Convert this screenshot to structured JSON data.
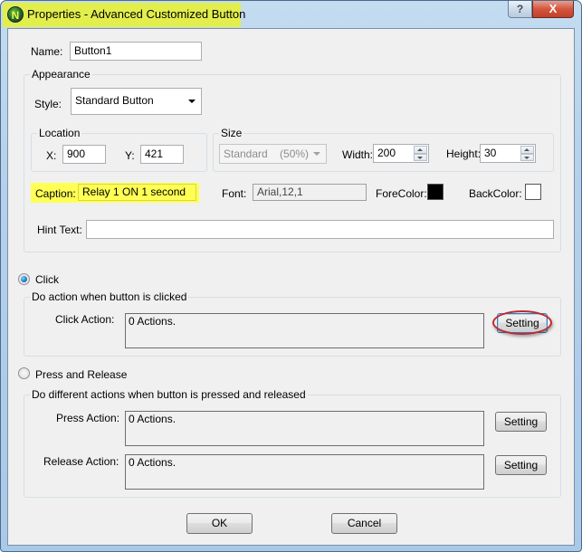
{
  "window": {
    "title": "Properties - Advanced Customized Button",
    "app_icon_letter": "N",
    "help_glyph": "?",
    "close_glyph": "X"
  },
  "name": {
    "label": "Name:",
    "value": "Button1"
  },
  "appearance": {
    "legend": "Appearance",
    "style": {
      "label": "Style:",
      "value": "Standard Button"
    },
    "location": {
      "legend": "Location",
      "x_label": "X:",
      "x_value": "900",
      "y_label": "Y:",
      "y_value": "421"
    },
    "size": {
      "legend": "Size",
      "preset_value": "Standard    (50%)",
      "width_label": "Width:",
      "width_value": "200",
      "height_label": "Height:",
      "height_value": "30"
    },
    "caption": {
      "label": "Caption:",
      "value": "Relay 1 ON 1 second",
      "highlight_color": "#ffff55"
    },
    "font": {
      "label": "Font:",
      "value": "Arial,12,1"
    },
    "forecolor": {
      "label": "ForeColor:",
      "color": "#000000"
    },
    "backcolor": {
      "label": "BackColor:",
      "color": "#ffffff"
    },
    "hint": {
      "label": "Hint Text:",
      "value": ""
    }
  },
  "click_mode": {
    "label": "Click",
    "selected": true,
    "group_legend": "Do action when button is clicked",
    "action_label": "Click Action:",
    "action_value": "0 Actions.",
    "setting_label": "Setting"
  },
  "press_release_mode": {
    "label": "Press and Release",
    "selected": false,
    "group_legend": "Do different actions when button is pressed and released",
    "press_label": "Press Action:",
    "press_value": "0 Actions.",
    "press_setting_label": "Setting",
    "release_label": "Release Action:",
    "release_value": "0 Actions.",
    "release_setting_label": "Setting"
  },
  "footer": {
    "ok_label": "OK",
    "cancel_label": "Cancel"
  }
}
